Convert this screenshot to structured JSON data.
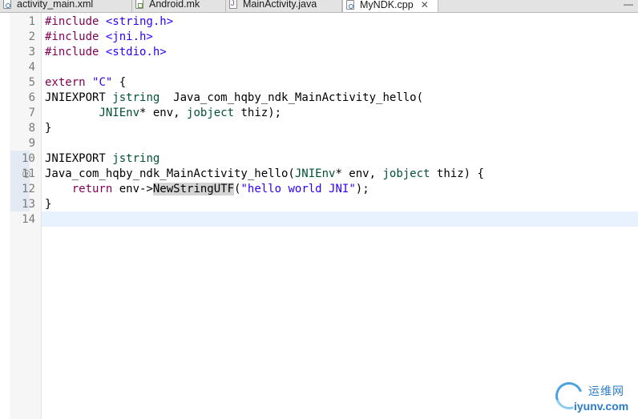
{
  "tabs": [
    {
      "label": "activity_main.xml",
      "icon": "xml-file-icon"
    },
    {
      "label": "Android.mk",
      "icon": "mk-file-icon"
    },
    {
      "label": "MainActivity.java",
      "icon": "java-file-icon"
    },
    {
      "label": "MyNDK.cpp",
      "icon": "cpp-file-icon",
      "active": true
    }
  ],
  "tab_close_glyph": "✕",
  "tabbar_overflow": "—",
  "editor": {
    "line_numbers": [
      "1",
      "2",
      "3",
      "4",
      "5",
      "6",
      "7",
      "8",
      "9",
      "10",
      "11",
      "12",
      "13",
      "14"
    ],
    "fold_marker": "⊖",
    "lines": [
      [
        "#include ",
        "<string.h>"
      ],
      [
        "#include ",
        "<jni.h>"
      ],
      [
        "#include ",
        "<stdio.h>"
      ],
      [],
      [
        "extern ",
        "\"C\"",
        " {"
      ],
      [
        "JNIEXPORT ",
        "jstring",
        "  Java_com_hqby_ndk_MainActivity_hello("
      ],
      [
        "        ",
        "JNIEnv",
        "* env, ",
        "jobject",
        " thiz);"
      ],
      [
        "}"
      ],
      [],
      [
        "JNIEXPORT ",
        "jstring"
      ],
      [
        "Java_com_hqby_ndk_MainActivity_hello(",
        "JNIEnv",
        "* env, ",
        "jobject",
        " thiz) {"
      ],
      [
        "    ",
        "return",
        " env->",
        "NewStringUTF",
        "(",
        "\"hello world JNI\"",
        ");"
      ],
      [
        "}"
      ],
      []
    ]
  },
  "watermark": {
    "cn_text": "运维网",
    "url_text": "iyunv.com"
  },
  "colors": {
    "keyword": "#7f0055",
    "type": "#005032",
    "string": "#2a00ff",
    "current_line": "#e8f2fe"
  }
}
